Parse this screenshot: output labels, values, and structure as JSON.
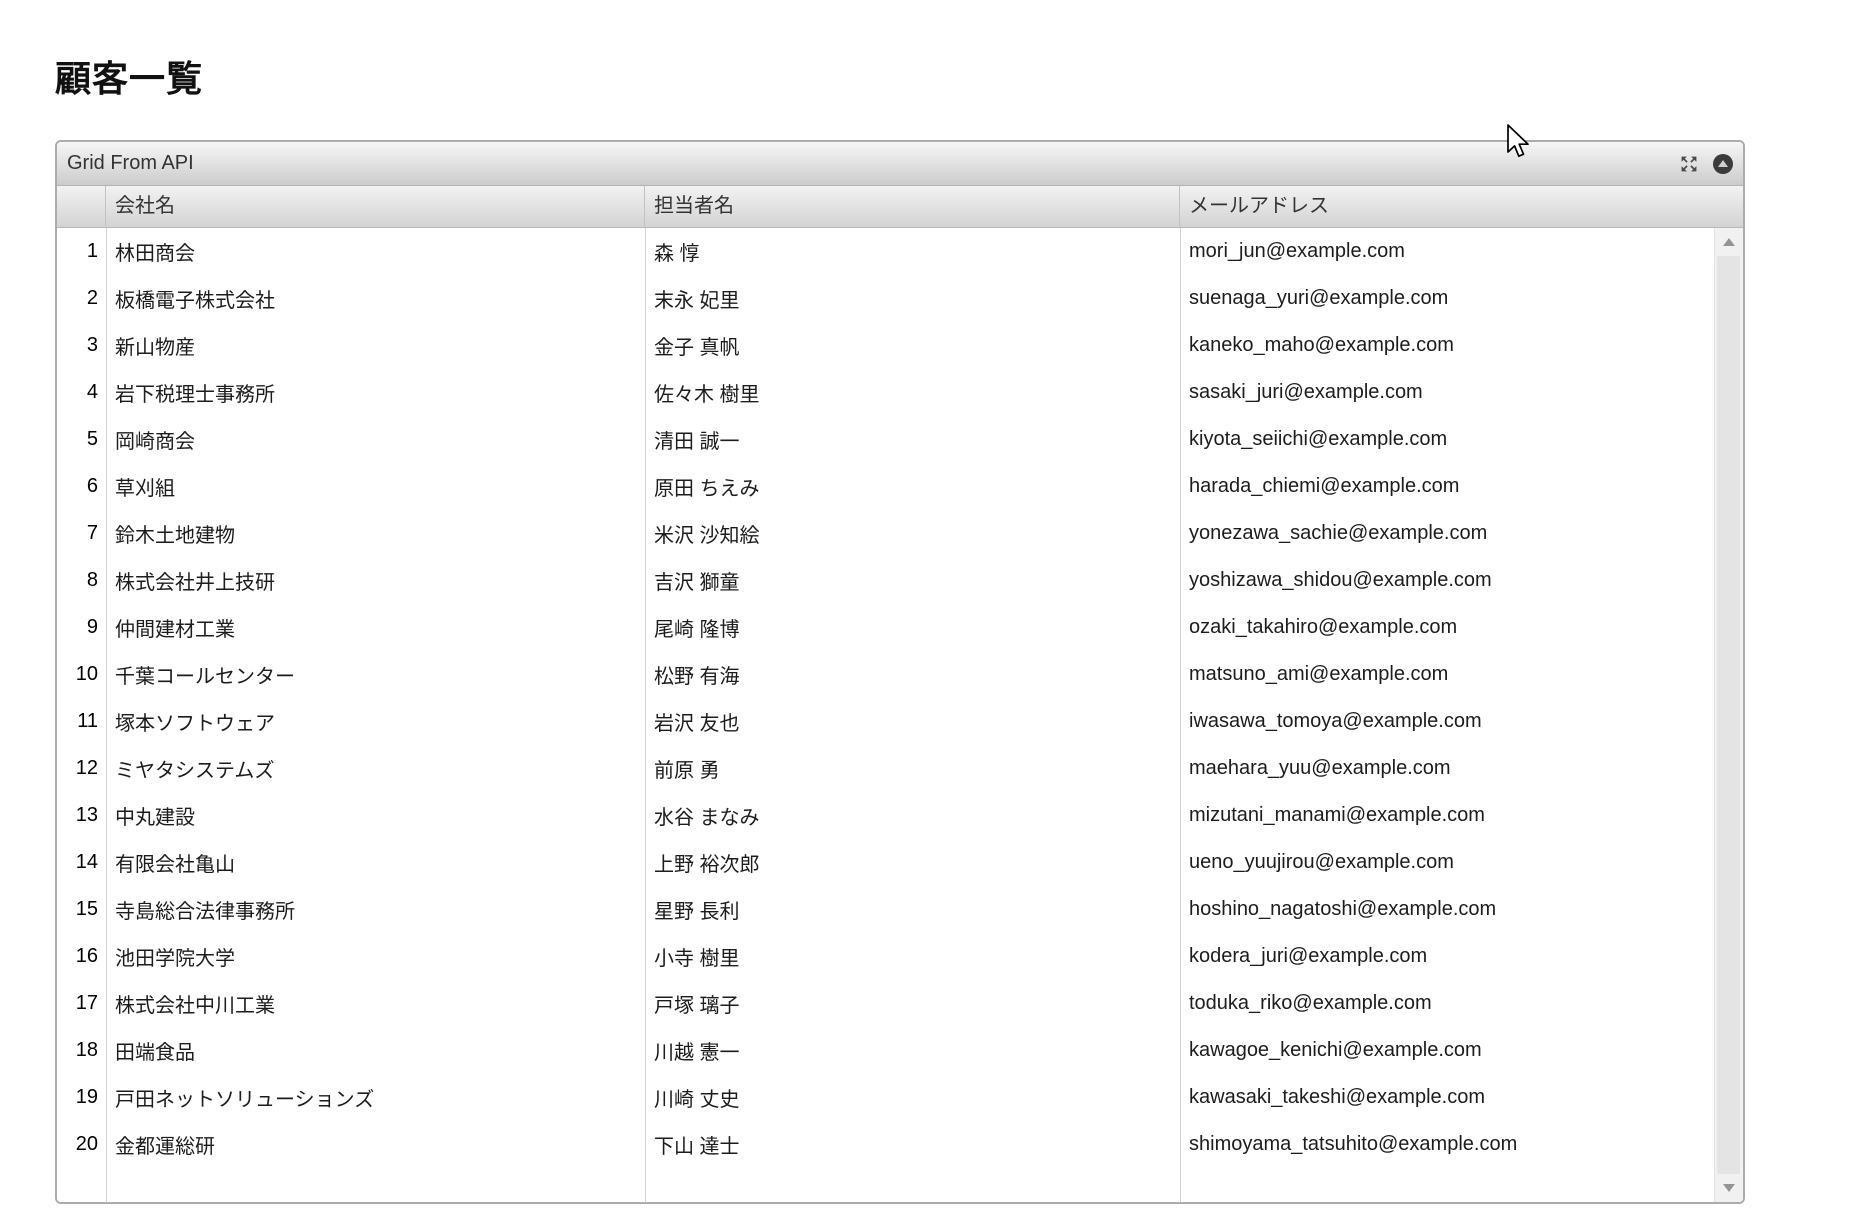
{
  "page": {
    "title": "顧客一覧"
  },
  "grid": {
    "caption": "Grid From API",
    "icons": {
      "maximize": "expand-arrows",
      "collapse": "circle-triangle-up",
      "scroll_up": "▲",
      "scroll_down": "▼"
    },
    "columns": [
      "会社名",
      "担当者名",
      "メールアドレス"
    ],
    "rows": [
      {
        "num": "1",
        "company": "林田商会",
        "contact": "森 惇",
        "email": "mori_jun@example.com"
      },
      {
        "num": "2",
        "company": "板橋電子株式会社",
        "contact": "末永 妃里",
        "email": "suenaga_yuri@example.com"
      },
      {
        "num": "3",
        "company": "新山物産",
        "contact": "金子 真帆",
        "email": "kaneko_maho@example.com"
      },
      {
        "num": "4",
        "company": "岩下税理士事務所",
        "contact": "佐々木 樹里",
        "email": "sasaki_juri@example.com"
      },
      {
        "num": "5",
        "company": "岡崎商会",
        "contact": "清田 誠一",
        "email": "kiyota_seiichi@example.com"
      },
      {
        "num": "6",
        "company": "草刈組",
        "contact": "原田 ちえみ",
        "email": "harada_chiemi@example.com"
      },
      {
        "num": "7",
        "company": "鈴木土地建物",
        "contact": "米沢 沙知絵",
        "email": "yonezawa_sachie@example.com"
      },
      {
        "num": "8",
        "company": "株式会社井上技研",
        "contact": "吉沢 獅童",
        "email": "yoshizawa_shidou@example.com"
      },
      {
        "num": "9",
        "company": "仲間建材工業",
        "contact": "尾崎 隆博",
        "email": "ozaki_takahiro@example.com"
      },
      {
        "num": "10",
        "company": "千葉コールセンター",
        "contact": "松野 有海",
        "email": "matsuno_ami@example.com"
      },
      {
        "num": "11",
        "company": "塚本ソフトウェア",
        "contact": "岩沢 友也",
        "email": "iwasawa_tomoya@example.com"
      },
      {
        "num": "12",
        "company": "ミヤタシステムズ",
        "contact": "前原 勇",
        "email": "maehara_yuu@example.com"
      },
      {
        "num": "13",
        "company": "中丸建設",
        "contact": "水谷 まなみ",
        "email": "mizutani_manami@example.com"
      },
      {
        "num": "14",
        "company": "有限会社亀山",
        "contact": "上野 裕次郎",
        "email": "ueno_yuujirou@example.com"
      },
      {
        "num": "15",
        "company": "寺島総合法律事務所",
        "contact": "星野 長利",
        "email": "hoshino_nagatoshi@example.com"
      },
      {
        "num": "16",
        "company": "池田学院大学",
        "contact": "小寺 樹里",
        "email": "kodera_juri@example.com"
      },
      {
        "num": "17",
        "company": "株式会社中川工業",
        "contact": "戸塚 璃子",
        "email": "toduka_riko@example.com"
      },
      {
        "num": "18",
        "company": "田端食品",
        "contact": "川越 憲一",
        "email": "kawagoe_kenichi@example.com"
      },
      {
        "num": "19",
        "company": "戸田ネットソリューションズ",
        "contact": "川崎 丈史",
        "email": "kawasaki_takeshi@example.com"
      },
      {
        "num": "20",
        "company": "金都運総研",
        "contact": "下山 達士",
        "email": "shimoyama_tatsuhito@example.com"
      }
    ]
  }
}
